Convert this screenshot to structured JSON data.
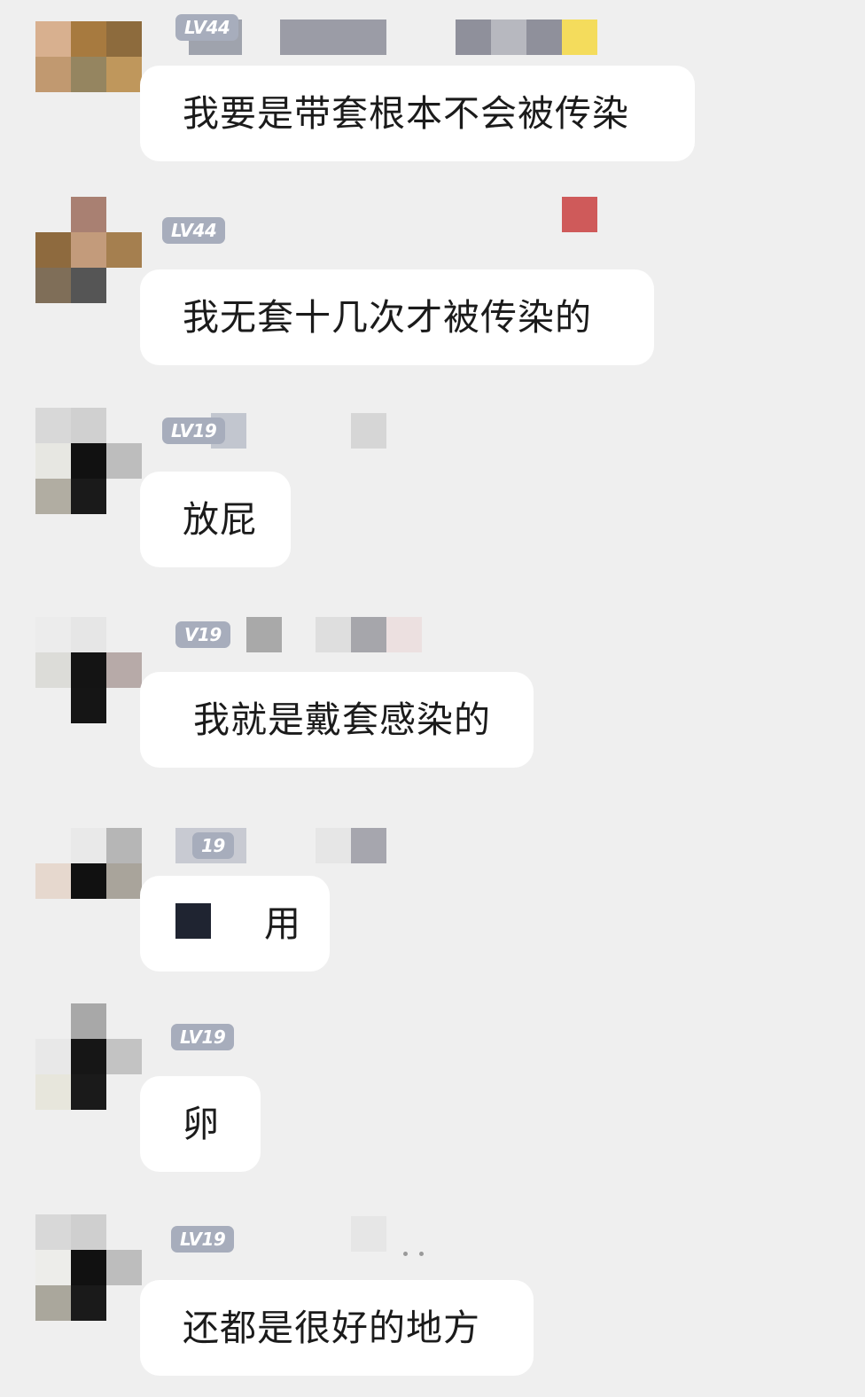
{
  "messages": [
    {
      "level": "LV44",
      "text": "我要是带套根本不会被传染",
      "avatar_colors": [
        "#d8b08f",
        "#a77a3f",
        "#8d6b3d",
        "#c19970",
        "#958560",
        "#bf975c",
        "#efefef",
        "#efefef",
        "#efefef"
      ],
      "name_blocks": [
        [
          "#8f909b",
          "#8f909b"
        ],
        [
          "#9c9ca6",
          "#b7b8bf",
          "#8f909b",
          "#f4dc5c"
        ]
      ]
    },
    {
      "level": "LV44",
      "text": "我无套十几次才被传染的",
      "avatar_colors": [
        "#efefef",
        "#a98072",
        "#efefef",
        "#8e6a3e",
        "#c39b7b",
        "#a57f4f",
        "#7f6e58",
        "#555555",
        "#efefef"
      ],
      "name_blocks": [
        [
          "#cf5a5a"
        ]
      ]
    },
    {
      "level": "LV19",
      "text": "放屁",
      "avatar_colors": [
        "#d8d8d8",
        "#d0d0d0",
        "#efefef",
        "#e7e7e2",
        "#111111",
        "#bdbdbd",
        "#b1ada2",
        "#1a1a1a",
        "#efefef"
      ],
      "name_blocks": [
        [
          "#c2c6cf"
        ],
        [
          "#d6d6d6"
        ]
      ]
    },
    {
      "level": "V19",
      "text": "我就是戴套感染的",
      "avatar_colors": [
        "#ececec",
        "#e6e6e6",
        "#efefef",
        "#dcdcd8",
        "#141414",
        "#b7aaa8",
        "#efefef",
        "#151515",
        "#efefef"
      ],
      "name_blocks": [
        [
          "#a9a9a9",
          "#7e7e7e"
        ],
        [
          "#dedede",
          "#a6a6ab",
          "#ece0e0"
        ]
      ]
    },
    {
      "level": "19",
      "text": "用",
      "avatar_colors": [
        "#efefef",
        "#e9e9e9",
        "#b6b6b6",
        "#e6d8ce",
        "#111111",
        "#a9a49b",
        "#efefef",
        "#efefef",
        "#efefef"
      ],
      "name_blocks": [
        [
          "#c8cad2"
        ],
        [
          "#e6e6e6",
          "#a6a6ae"
        ]
      ]
    },
    {
      "level": "LV19",
      "text": "卵",
      "avatar_colors": [
        "#efefef",
        "#a8a8a8",
        "#efefef",
        "#e8e8e8",
        "#161616",
        "#c3c3c3",
        "#e7e6dc",
        "#1a1a1a",
        "#efefef"
      ],
      "name_blocks": []
    },
    {
      "level": "LV19",
      "text": "还都是很好的地方",
      "avatar_colors": [
        "#d8d8d8",
        "#cfcfcf",
        "#efefef",
        "#ededea",
        "#111111",
        "#bdbdbd",
        "#aaa79c",
        "#1a1a1a",
        "#efefef"
      ],
      "name_blocks": [
        [
          "#d6d6d6"
        ],
        [
          "#e6e6e6"
        ]
      ]
    }
  ]
}
